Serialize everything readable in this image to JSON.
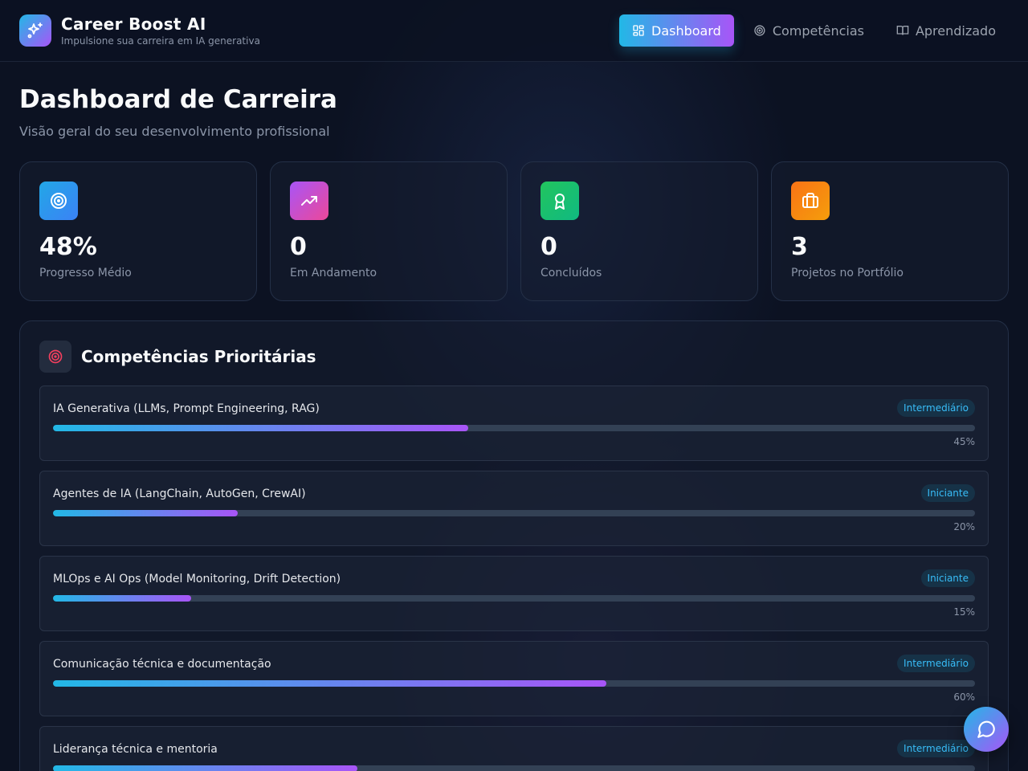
{
  "app": {
    "title": "Career Boost AI",
    "subtitle": "Impulsione sua carreira em IA generativa",
    "logo_icon": "sparkles-icon"
  },
  "nav": {
    "items": [
      {
        "label": "Dashboard",
        "icon": "grid-icon",
        "active": true
      },
      {
        "label": "Competências",
        "icon": "target-icon",
        "active": false
      },
      {
        "label": "Aprendizado",
        "icon": "book-icon",
        "active": false
      }
    ]
  },
  "page": {
    "title": "Dashboard de Carreira",
    "subtitle": "Visão geral do seu desenvolvimento profissional"
  },
  "stats": [
    {
      "value": "48%",
      "label": "Progresso Médio",
      "icon": "target-icon",
      "color": "#0ea5e9"
    },
    {
      "value": "0",
      "label": "Em Andamento",
      "icon": "trending-up-icon",
      "color": "#c026d3"
    },
    {
      "value": "0",
      "label": "Concluídos",
      "icon": "award-icon",
      "color": "#16a34a"
    },
    {
      "value": "3",
      "label": "Projetos no Portfólio",
      "icon": "briefcase-icon",
      "color": "#f97316"
    }
  ],
  "priority": {
    "title": "Competências Prioritárias",
    "icon": "target-icon",
    "skills": [
      {
        "name": "IA Generativa (LLMs, Prompt Engineering, RAG)",
        "level": "Intermediário",
        "progress": 45,
        "progress_label": "45%"
      },
      {
        "name": "Agentes de IA (LangChain, AutoGen, CrewAI)",
        "level": "Iniciante",
        "progress": 20,
        "progress_label": "20%"
      },
      {
        "name": "MLOps e AI Ops (Model Monitoring, Drift Detection)",
        "level": "Iniciante",
        "progress": 15,
        "progress_label": "15%"
      },
      {
        "name": "Comunicação técnica e documentação",
        "level": "Intermediário",
        "progress": 60,
        "progress_label": "60%"
      },
      {
        "name": "Liderança técnica e mentoria",
        "level": "Intermediário",
        "progress": 33,
        "progress_label": ""
      }
    ]
  },
  "chat": {
    "icon": "chat-bubble-icon"
  }
}
